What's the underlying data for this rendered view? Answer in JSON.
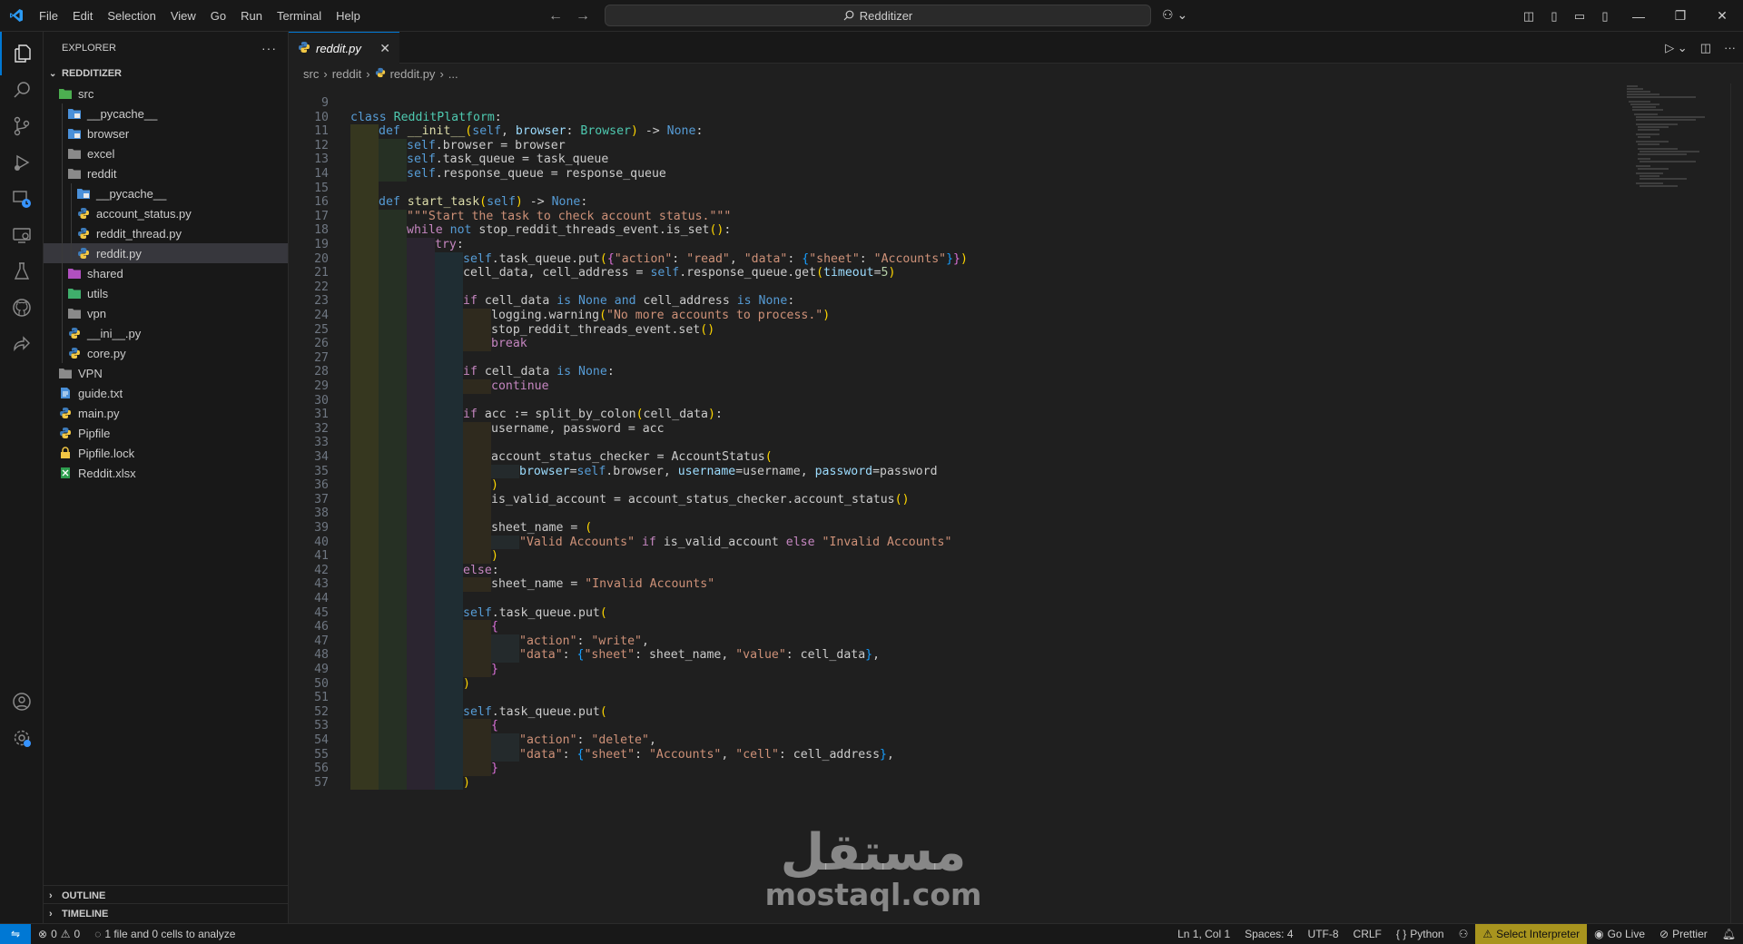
{
  "titlebar": {
    "menu": [
      "File",
      "Edit",
      "Selection",
      "View",
      "Go",
      "Run",
      "Terminal",
      "Help"
    ],
    "search_text": "Redditizer"
  },
  "explorer": {
    "header": "EXPLORER",
    "root": "REDDITIZER",
    "items": [
      {
        "label": "src",
        "depth": 0,
        "type": "folder-src",
        "open": true
      },
      {
        "label": "__pycache__",
        "depth": 1,
        "type": "folder-blue"
      },
      {
        "label": "browser",
        "depth": 1,
        "type": "folder-blue"
      },
      {
        "label": "excel",
        "depth": 1,
        "type": "folder"
      },
      {
        "label": "reddit",
        "depth": 1,
        "type": "folder",
        "open": true
      },
      {
        "label": "__pycache__",
        "depth": 2,
        "type": "folder-blue"
      },
      {
        "label": "account_status.py",
        "depth": 2,
        "type": "python"
      },
      {
        "label": "reddit_thread.py",
        "depth": 2,
        "type": "python"
      },
      {
        "label": "reddit.py",
        "depth": 2,
        "type": "python",
        "selected": true
      },
      {
        "label": "shared",
        "depth": 1,
        "type": "folder-purple"
      },
      {
        "label": "utils",
        "depth": 1,
        "type": "folder-green"
      },
      {
        "label": "vpn",
        "depth": 1,
        "type": "folder"
      },
      {
        "label": "__ini__.py",
        "depth": 1,
        "type": "python"
      },
      {
        "label": "core.py",
        "depth": 1,
        "type": "python"
      },
      {
        "label": "VPN",
        "depth": 0,
        "type": "folder"
      },
      {
        "label": "guide.txt",
        "depth": 0,
        "type": "text"
      },
      {
        "label": "main.py",
        "depth": 0,
        "type": "python"
      },
      {
        "label": "Pipfile",
        "depth": 0,
        "type": "python"
      },
      {
        "label": "Pipfile.lock",
        "depth": 0,
        "type": "lock"
      },
      {
        "label": "Reddit.xlsx",
        "depth": 0,
        "type": "excel"
      }
    ],
    "outline": "OUTLINE",
    "timeline": "TIMELINE"
  },
  "editor": {
    "tab_label": "reddit.py",
    "breadcrumb": [
      "src",
      "reddit",
      "reddit.py",
      "..."
    ]
  },
  "code": [
    {
      "n": 9,
      "indent": 0,
      "toks": []
    },
    {
      "n": 10,
      "indent": 0,
      "toks": [
        [
          "k",
          "class "
        ],
        [
          "cls",
          "RedditPlatform"
        ],
        [
          "",
          ":"
        ]
      ]
    },
    {
      "n": 11,
      "indent": 1,
      "toks": [
        [
          "k",
          "def "
        ],
        [
          "f",
          "__init__"
        ],
        [
          "b1",
          "("
        ],
        [
          "k",
          "self"
        ],
        [
          "",
          ", "
        ],
        [
          "p",
          "browser"
        ],
        [
          "",
          ": "
        ],
        [
          "cls",
          "Browser"
        ],
        [
          "b1",
          ")"
        ],
        [
          "",
          " -> "
        ],
        [
          "k",
          "None"
        ],
        [
          "",
          ":"
        ]
      ]
    },
    {
      "n": 12,
      "indent": 2,
      "toks": [
        [
          "k",
          "self"
        ],
        [
          "",
          ".browser = browser"
        ]
      ]
    },
    {
      "n": 13,
      "indent": 2,
      "toks": [
        [
          "k",
          "self"
        ],
        [
          "",
          ".task_queue = task_queue"
        ]
      ]
    },
    {
      "n": 14,
      "indent": 2,
      "toks": [
        [
          "k",
          "self"
        ],
        [
          "",
          ".response_queue = response_queue"
        ]
      ]
    },
    {
      "n": 15,
      "indent": 1,
      "toks": []
    },
    {
      "n": 16,
      "indent": 1,
      "toks": [
        [
          "k",
          "def "
        ],
        [
          "f",
          "start_task"
        ],
        [
          "b1",
          "("
        ],
        [
          "k",
          "self"
        ],
        [
          "b1",
          ")"
        ],
        [
          "",
          " -> "
        ],
        [
          "k",
          "None"
        ],
        [
          "",
          ":"
        ]
      ]
    },
    {
      "n": 17,
      "indent": 2,
      "toks": [
        [
          "s",
          "\"\"\"Start the task to check account status.\"\"\""
        ]
      ]
    },
    {
      "n": 18,
      "indent": 2,
      "toks": [
        [
          "c",
          "while "
        ],
        [
          "k",
          "not "
        ],
        [
          "",
          "stop_reddit_threads_event.is_set"
        ],
        [
          "b1",
          "()"
        ],
        [
          "",
          ":"
        ]
      ]
    },
    {
      "n": 19,
      "indent": 3,
      "toks": [
        [
          "c",
          "try"
        ],
        [
          "",
          ":"
        ]
      ]
    },
    {
      "n": 20,
      "indent": 4,
      "toks": [
        [
          "k",
          "self"
        ],
        [
          "",
          ".task_queue.put"
        ],
        [
          "b1",
          "("
        ],
        [
          "b2",
          "{"
        ],
        [
          "s",
          "\"action\""
        ],
        [
          "",
          ": "
        ],
        [
          "s",
          "\"read\""
        ],
        [
          "",
          ", "
        ],
        [
          "s",
          "\"data\""
        ],
        [
          "",
          ": "
        ],
        [
          "b3",
          "{"
        ],
        [
          "s",
          "\"sheet\""
        ],
        [
          "",
          ": "
        ],
        [
          "s",
          "\"Accounts\""
        ],
        [
          "b3",
          "}"
        ],
        [
          "b2",
          "}"
        ],
        [
          "b1",
          ")"
        ]
      ]
    },
    {
      "n": 21,
      "indent": 4,
      "toks": [
        [
          "",
          "cell_data, cell_address = "
        ],
        [
          "k",
          "self"
        ],
        [
          "",
          ".response_queue.get"
        ],
        [
          "b1",
          "("
        ],
        [
          "p",
          "timeout"
        ],
        [
          "",
          "="
        ],
        [
          "n",
          "5"
        ],
        [
          "b1",
          ")"
        ]
      ]
    },
    {
      "n": 22,
      "indent": 4,
      "toks": []
    },
    {
      "n": 23,
      "indent": 4,
      "toks": [
        [
          "c",
          "if "
        ],
        [
          "",
          "cell_data "
        ],
        [
          "k",
          "is None and "
        ],
        [
          "",
          "cell_address "
        ],
        [
          "k",
          "is None"
        ],
        [
          "",
          ":"
        ]
      ]
    },
    {
      "n": 24,
      "indent": 5,
      "toks": [
        [
          "",
          "logging.warning"
        ],
        [
          "b1",
          "("
        ],
        [
          "s",
          "\"No more accounts to process.\""
        ],
        [
          "b1",
          ")"
        ]
      ]
    },
    {
      "n": 25,
      "indent": 5,
      "toks": [
        [
          "",
          "stop_reddit_threads_event.set"
        ],
        [
          "b1",
          "()"
        ]
      ]
    },
    {
      "n": 26,
      "indent": 5,
      "toks": [
        [
          "c",
          "break"
        ]
      ]
    },
    {
      "n": 27,
      "indent": 4,
      "toks": []
    },
    {
      "n": 28,
      "indent": 4,
      "toks": [
        [
          "c",
          "if "
        ],
        [
          "",
          "cell_data "
        ],
        [
          "k",
          "is None"
        ],
        [
          "",
          ":"
        ]
      ]
    },
    {
      "n": 29,
      "indent": 5,
      "toks": [
        [
          "c",
          "continue"
        ]
      ]
    },
    {
      "n": 30,
      "indent": 4,
      "toks": []
    },
    {
      "n": 31,
      "indent": 4,
      "toks": [
        [
          "c",
          "if "
        ],
        [
          "",
          "acc := split_by_colon"
        ],
        [
          "b1",
          "("
        ],
        [
          "",
          "cell_data"
        ],
        [
          "b1",
          ")"
        ],
        [
          "",
          ":"
        ]
      ]
    },
    {
      "n": 32,
      "indent": 5,
      "toks": [
        [
          "",
          "username, password = acc"
        ]
      ]
    },
    {
      "n": 33,
      "indent": 5,
      "toks": []
    },
    {
      "n": 34,
      "indent": 5,
      "toks": [
        [
          "",
          "account_status_checker = AccountStatus"
        ],
        [
          "b1",
          "("
        ]
      ]
    },
    {
      "n": 35,
      "indent": 6,
      "toks": [
        [
          "p",
          "browser"
        ],
        [
          "",
          "="
        ],
        [
          "k",
          "self"
        ],
        [
          "",
          ".browser, "
        ],
        [
          "p",
          "username"
        ],
        [
          "",
          "=username, "
        ],
        [
          "p",
          "password"
        ],
        [
          "",
          "=password"
        ]
      ]
    },
    {
      "n": 36,
      "indent": 5,
      "toks": [
        [
          "b1",
          ")"
        ]
      ]
    },
    {
      "n": 37,
      "indent": 5,
      "toks": [
        [
          "",
          "is_valid_account = account_status_checker.account_status"
        ],
        [
          "b1",
          "()"
        ]
      ]
    },
    {
      "n": 38,
      "indent": 5,
      "toks": []
    },
    {
      "n": 39,
      "indent": 5,
      "toks": [
        [
          "",
          "sheet_name = "
        ],
        [
          "b1",
          "("
        ]
      ]
    },
    {
      "n": 40,
      "indent": 6,
      "toks": [
        [
          "s",
          "\"Valid Accounts\""
        ],
        [
          "c",
          " if "
        ],
        [
          "",
          "is_valid_account "
        ],
        [
          "c",
          "else "
        ],
        [
          "s",
          "\"Invalid Accounts\""
        ]
      ]
    },
    {
      "n": 41,
      "indent": 5,
      "toks": [
        [
          "b1",
          ")"
        ]
      ]
    },
    {
      "n": 42,
      "indent": 4,
      "toks": [
        [
          "c",
          "else"
        ],
        [
          "",
          ":"
        ]
      ]
    },
    {
      "n": 43,
      "indent": 5,
      "toks": [
        [
          "",
          "sheet_name = "
        ],
        [
          "s",
          "\"Invalid Accounts\""
        ]
      ]
    },
    {
      "n": 44,
      "indent": 4,
      "toks": []
    },
    {
      "n": 45,
      "indent": 4,
      "toks": [
        [
          "k",
          "self"
        ],
        [
          "",
          ".task_queue.put"
        ],
        [
          "b1",
          "("
        ]
      ]
    },
    {
      "n": 46,
      "indent": 5,
      "toks": [
        [
          "b2",
          "{"
        ]
      ]
    },
    {
      "n": 47,
      "indent": 6,
      "toks": [
        [
          "s",
          "\"action\""
        ],
        [
          "",
          ": "
        ],
        [
          "s",
          "\"write\""
        ],
        [
          "",
          ","
        ]
      ]
    },
    {
      "n": 48,
      "indent": 6,
      "toks": [
        [
          "s",
          "\"data\""
        ],
        [
          "",
          ": "
        ],
        [
          "b3",
          "{"
        ],
        [
          "s",
          "\"sheet\""
        ],
        [
          "",
          ": sheet_name, "
        ],
        [
          "s",
          "\"value\""
        ],
        [
          "",
          ": cell_data"
        ],
        [
          "b3",
          "}"
        ],
        [
          "",
          ","
        ]
      ]
    },
    {
      "n": 49,
      "indent": 5,
      "toks": [
        [
          "b2",
          "}"
        ]
      ]
    },
    {
      "n": 50,
      "indent": 4,
      "toks": [
        [
          "b1",
          ")"
        ]
      ]
    },
    {
      "n": 51,
      "indent": 4,
      "toks": []
    },
    {
      "n": 52,
      "indent": 4,
      "toks": [
        [
          "k",
          "self"
        ],
        [
          "",
          ".task_queue.put"
        ],
        [
          "b1",
          "("
        ]
      ]
    },
    {
      "n": 53,
      "indent": 5,
      "toks": [
        [
          "b2",
          "{"
        ]
      ]
    },
    {
      "n": 54,
      "indent": 6,
      "toks": [
        [
          "s",
          "\"action\""
        ],
        [
          "",
          ": "
        ],
        [
          "s",
          "\"delete\""
        ],
        [
          "",
          ","
        ]
      ]
    },
    {
      "n": 55,
      "indent": 6,
      "toks": [
        [
          "s",
          "\"data\""
        ],
        [
          "",
          ": "
        ],
        [
          "b3",
          "{"
        ],
        [
          "s",
          "\"sheet\""
        ],
        [
          "",
          ": "
        ],
        [
          "s",
          "\"Accounts\""
        ],
        [
          "",
          ", "
        ],
        [
          "s",
          "\"cell\""
        ],
        [
          "",
          ": cell_address"
        ],
        [
          "b3",
          "}"
        ],
        [
          "",
          ","
        ]
      ]
    },
    {
      "n": 56,
      "indent": 5,
      "toks": [
        [
          "b2",
          "}"
        ]
      ]
    },
    {
      "n": 57,
      "indent": 4,
      "toks": [
        [
          "b1",
          ")"
        ]
      ]
    }
  ],
  "watermark": {
    "arabic": "مستقل",
    "latin": "mostaql.com"
  },
  "statusbar": {
    "errors": "0",
    "warnings": "0",
    "analysis": "1 file and 0 cells to analyze",
    "position": "Ln 1, Col 1",
    "spaces": "Spaces: 4",
    "encoding": "UTF-8",
    "eol": "CRLF",
    "language": "Python",
    "interpreter": "Select Interpreter",
    "golive": "Go Live",
    "prettier": "Prettier"
  },
  "colors": {
    "accent": "#0078d4",
    "warning_bg": "#a8941e"
  }
}
